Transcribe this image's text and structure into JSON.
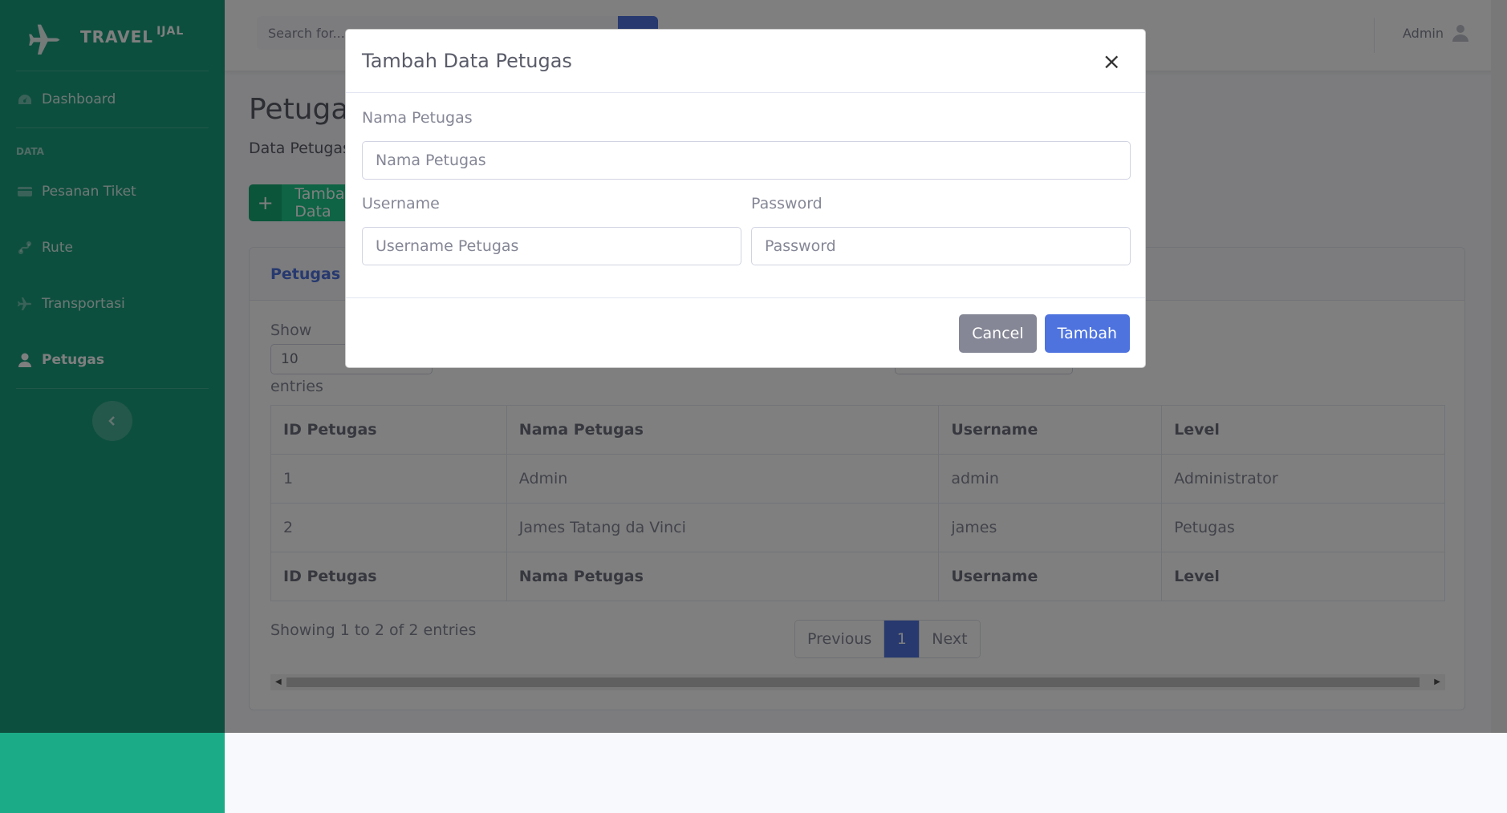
{
  "brand": {
    "name": "TRAVEL",
    "sup": "IJAL"
  },
  "sidebar": {
    "items": [
      {
        "label": "Dashboard"
      },
      {
        "heading": "DATA"
      },
      {
        "label": "Pesanan Tiket"
      },
      {
        "label": "Rute"
      },
      {
        "label": "Transportasi"
      },
      {
        "label": "Petugas"
      }
    ]
  },
  "topbar": {
    "search_placeholder": "Search for...",
    "user_name": "Admin"
  },
  "page": {
    "title": "Petugas",
    "subtitle": "Data Petugas",
    "add_button": "Tambah Data",
    "card_title": "Petugas",
    "show_label": "Show",
    "show_value": "10",
    "entries_label": "entries",
    "columns": [
      "ID Petugas",
      "Nama Petugas",
      "Username",
      "Level"
    ],
    "rows": [
      [
        "1",
        "Admin",
        "admin",
        "Administrator"
      ],
      [
        "2",
        "James Tatang da Vinci",
        "james",
        "Petugas"
      ]
    ],
    "info": "Showing 1 to 2 of 2 entries",
    "pager": {
      "prev": "Previous",
      "current": "1",
      "next": "Next"
    }
  },
  "modal": {
    "title": "Tambah Data Petugas",
    "close": "×",
    "nama_label": "Nama Petugas",
    "nama_placeholder": "Nama Petugas",
    "username_label": "Username",
    "username_placeholder": "Username Petugas",
    "password_label": "Password",
    "password_placeholder": "Password",
    "cancel": "Cancel",
    "submit": "Tambah"
  },
  "colors": {
    "sidebar": "#1a9e7c",
    "primary": "#4e73df",
    "success": "#1cc88a",
    "secondary": "#858796"
  }
}
